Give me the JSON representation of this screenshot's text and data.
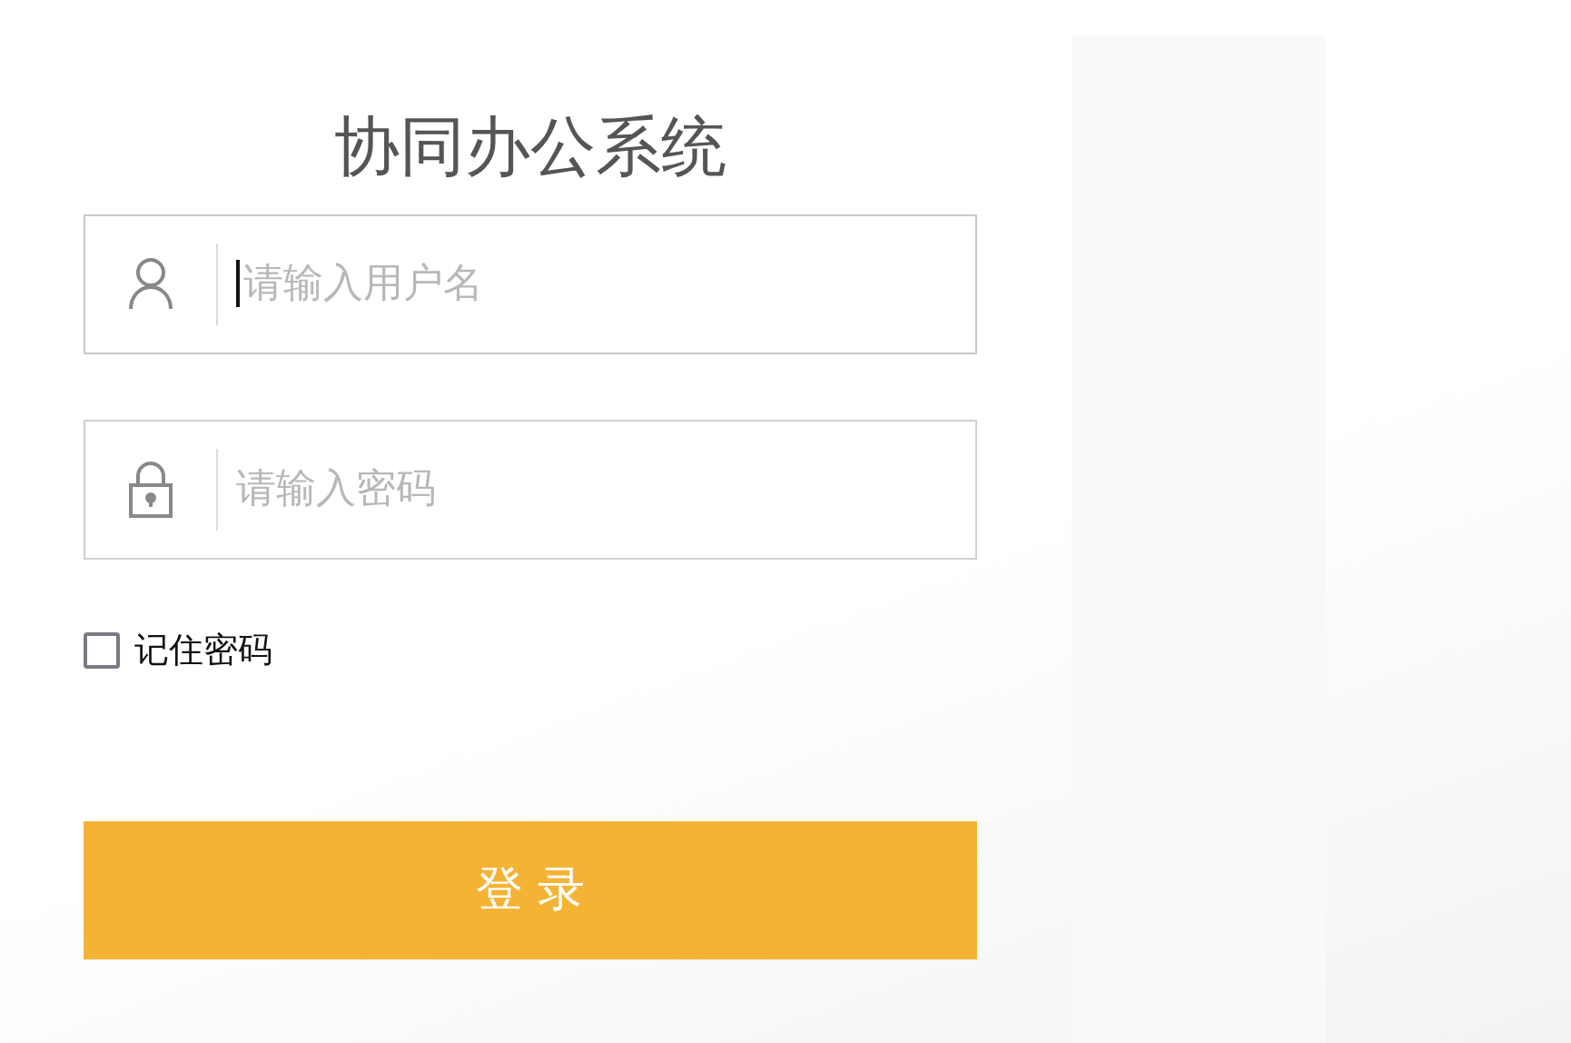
{
  "title": "协同办公系统",
  "fields": [
    {
      "kind": "user",
      "placeholder": "请输入用户名",
      "focused": true
    },
    {
      "kind": "lock",
      "placeholder": "请输入密码",
      "focused": false
    }
  ],
  "remember": {
    "label": "记住密码",
    "checked": false
  },
  "login_button": {
    "label": "登 录"
  }
}
